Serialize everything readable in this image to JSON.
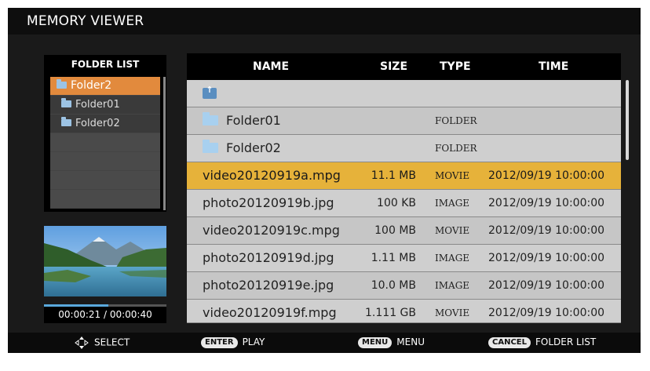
{
  "title": "MEMORY VIEWER",
  "folder_list": {
    "header": "FOLDER LIST",
    "items": [
      {
        "label": "Folder2",
        "selected": true,
        "indent": 0
      },
      {
        "label": "Folder01",
        "selected": false,
        "indent": 1
      },
      {
        "label": "Folder02",
        "selected": false,
        "indent": 1
      }
    ]
  },
  "playback": {
    "time": "00:00:21 / 00:00:40",
    "progress": 0.525
  },
  "table": {
    "headers": {
      "name": "NAME",
      "size": "SIZE",
      "type": "TYPE",
      "time": "TIME"
    },
    "rows": [
      {
        "kind": "up",
        "name": "",
        "size": "",
        "type": "",
        "time": ""
      },
      {
        "kind": "folder",
        "name": "Folder01",
        "size": "",
        "type": "FOLDER",
        "time": ""
      },
      {
        "kind": "folder",
        "name": "Folder02",
        "size": "",
        "type": "FOLDER",
        "time": ""
      },
      {
        "kind": "file",
        "name": "video20120919a.mpg",
        "size": "11.1 MB",
        "type": "MOVIE",
        "time": "2012/09/19  10:00:00",
        "selected": true
      },
      {
        "kind": "file",
        "name": "photo20120919b.jpg",
        "size": "100 KB",
        "type": "IMAGE",
        "time": "2012/09/19  10:00:00"
      },
      {
        "kind": "file",
        "name": "video20120919c.mpg",
        "size": "100 MB",
        "type": "MOVIE",
        "time": "2012/09/19  10:00:00"
      },
      {
        "kind": "file",
        "name": "photo20120919d.jpg",
        "size": "1.11 MB",
        "type": "IMAGE",
        "time": "2012/09/19  10:00:00"
      },
      {
        "kind": "file",
        "name": "photo20120919e.jpg",
        "size": "10.0 MB",
        "type": "IMAGE",
        "time": "2012/09/19  10:00:00"
      },
      {
        "kind": "file",
        "name": "video20120919f.mpg",
        "size": "1.111 GB",
        "type": "MOVIE",
        "time": "2012/09/19  10:00:00"
      }
    ]
  },
  "bottom_bar": {
    "select_label": "SELECT",
    "enter_key": "ENTER",
    "enter_label": "PLAY",
    "menu_key": "MENU",
    "menu_label": "MENU",
    "cancel_key": "CANCEL",
    "cancel_label": "FOLDER LIST"
  },
  "colors": {
    "selection_orange": "#e28a3d",
    "selection_gold": "#e6b23a",
    "progress_blue": "#5aa9dd"
  }
}
